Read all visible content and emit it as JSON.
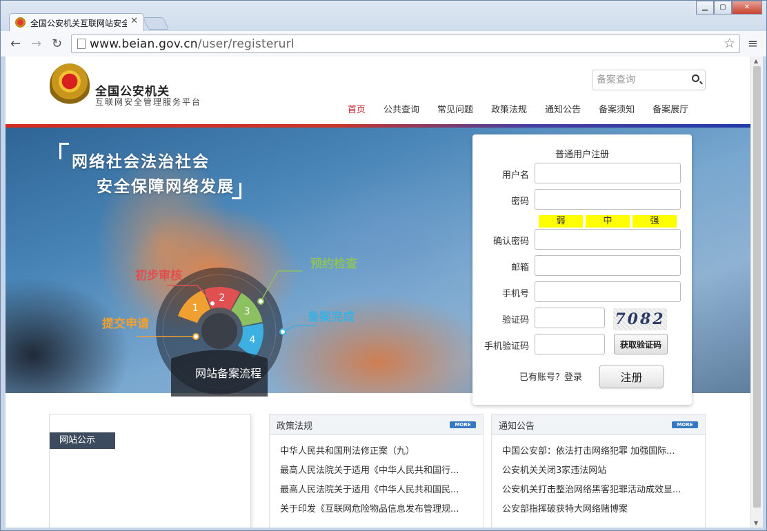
{
  "browser": {
    "tab_title": "全国公安机关互联网站安全",
    "url_host": "www.beian.gov.cn",
    "url_path": "/user/registerurl"
  },
  "header": {
    "logo_title": "全国公安机关",
    "logo_subtitle": "互联网安全管理服务平台",
    "search_placeholder": "备案查询",
    "nav": [
      {
        "label": "首页"
      },
      {
        "label": "公共查询"
      },
      {
        "label": "常见问题"
      },
      {
        "label": "政策法规"
      },
      {
        "label": "通知公告"
      },
      {
        "label": "备案须知"
      },
      {
        "label": "备案展厅"
      }
    ]
  },
  "banner": {
    "slogan_line1": "网络社会法治社会",
    "slogan_line2": "安全保障网络发展",
    "flow_title": "网站备案流程",
    "steps": [
      {
        "num": "1",
        "label": "提交申请",
        "color": "#f0a030"
      },
      {
        "num": "2",
        "label": "初步审核",
        "color": "#e05050"
      },
      {
        "num": "3",
        "label": "预约检查",
        "color": "#8cc060"
      },
      {
        "num": "4",
        "label": "备案完成",
        "color": "#3cb0e0"
      }
    ]
  },
  "register": {
    "title": "普通用户注册",
    "username_label": "用户名",
    "password_label": "密码",
    "strength": [
      "弱",
      "中",
      "强"
    ],
    "confirm_label": "确认密码",
    "email_label": "邮箱",
    "phone_label": "手机号",
    "captcha_label": "验证码",
    "captcha_text": "7082",
    "sms_label": "手机验证码",
    "sms_button": "获取验证码",
    "login_text": "已有账号？登录",
    "submit_label": "注册"
  },
  "panels": {
    "site_notice_title": "网站公示",
    "policy": {
      "title": "政策法规",
      "more": "MORE",
      "items": [
        "中华人民共和国刑法修正案（九）",
        "最高人民法院关于适用《中华人民共和国行...",
        "最高人民法院关于适用《中华人民共和国民...",
        "关于印发《互联网危险物品信息发布管理规..."
      ]
    },
    "notice": {
      "title": "通知公告",
      "more": "MORE",
      "items": [
        "中国公安部：依法打击网络犯罪 加强国际...",
        "公安机关关闭3家违法网站",
        "公安机关打击整治网络黑客犯罪活动成效显...",
        "公安部指挥破获特大网络赌博案"
      ]
    }
  }
}
